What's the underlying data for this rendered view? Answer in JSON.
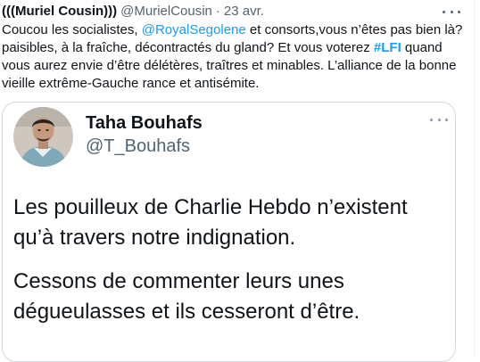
{
  "tweet": {
    "author_name": "(((Muriel Cousin)))",
    "author_handle": "@MurielCousin",
    "separator": "·",
    "date": "23 avr.",
    "more_icon": "more-dots-icon",
    "text_parts": {
      "p1": "Coucou les socialistes, ",
      "mention": "@RoyalSegolene",
      "p2": " et consorts,vous n’êtes pas bien là? paisibles, à la fraîche, décontractés du gland? Et vous voterez ",
      "hashtag": "#LFI",
      "p3": " quand vous aurez envie d’être délétères, traîtres et minables. L’alliance de la bonne vieille extrême-Gauche rance et antisémite."
    },
    "link_color": "#1d9bf0"
  },
  "quoted": {
    "name": "Taha Bouhafs",
    "handle": "@T_Bouhafs",
    "avatar": "profile-photo",
    "more_icon": "more-dots-icon",
    "paragraphs": [
      "Les pouilleux de Charlie Hebdo n’existent qu’à travers notre indignation.",
      "Cessons de commenter leurs unes dégueulasses et ils cesseront d’être."
    ]
  }
}
